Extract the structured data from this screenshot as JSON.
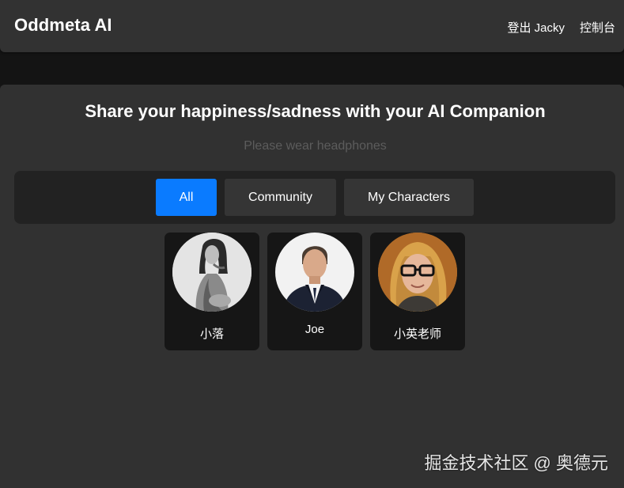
{
  "app": {
    "brand": "Oddmeta AI"
  },
  "nav": {
    "logout_label": "登出 Jacky",
    "console_label": "控制台"
  },
  "hero": {
    "title": "Share your happiness/sadness with your AI Companion",
    "subtitle": "Please wear headphones"
  },
  "tabs": [
    {
      "label": "All",
      "active": true
    },
    {
      "label": "Community",
      "active": false
    },
    {
      "label": "My Characters",
      "active": false
    }
  ],
  "characters": [
    {
      "name": "小落",
      "avatar": "grayscale-woman-portrait"
    },
    {
      "name": "Joe",
      "avatar": "man-in-suit-portrait"
    },
    {
      "name": "小英老师",
      "avatar": "woman-with-glasses-portrait"
    }
  ],
  "watermark": "掘金技术社区 @ 奥德元",
  "colors": {
    "accent": "#0a7bff",
    "navbar": "#323232",
    "panel": "#313131",
    "card": "#161616"
  }
}
